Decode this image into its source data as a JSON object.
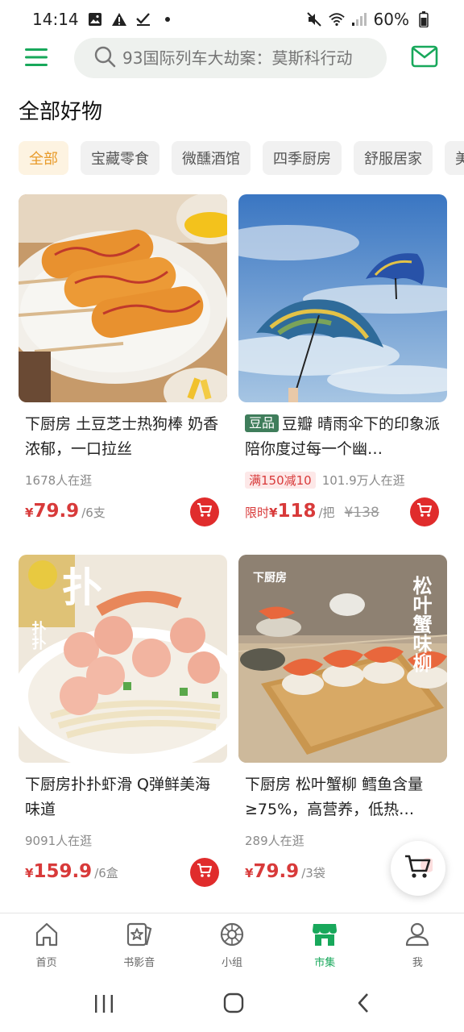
{
  "status_bar": {
    "time": "14:14",
    "battery": "60%"
  },
  "search": {
    "placeholder": "93国际列车大劫案：莫斯科行动"
  },
  "page_title": "全部好物",
  "chips": [
    "全部",
    "宝藏零食",
    "微醺酒馆",
    "四季厨房",
    "舒服居家",
    "美"
  ],
  "products": [
    {
      "title": "下厨房 土豆芝士热狗棒 奶香浓郁，一口拉丝",
      "tag": "",
      "meta": "1678人在逛",
      "coupon": "",
      "price_prefix": "",
      "currency": "¥",
      "price": "79.9",
      "unit": "/6支",
      "old_price": ""
    },
    {
      "title": "豆瓣 晴雨伞下的印象派 陪你度过每一个幽…",
      "tag": "豆品",
      "meta": "101.9万人在逛",
      "coupon": "满150减10",
      "price_prefix": "限时",
      "currency": "¥",
      "price": "118",
      "unit": "/把",
      "old_price": "¥138"
    },
    {
      "title": "下厨房扑扑虾滑 Q弹鲜美海味道",
      "tag": "",
      "meta": "9091人在逛",
      "coupon": "",
      "price_prefix": "",
      "currency": "¥",
      "price": "159.9",
      "unit": "/6盒",
      "old_price": ""
    },
    {
      "title": "下厨房 松叶蟹柳 鳕鱼含量≥75%，高营养，低热…",
      "tag": "",
      "meta": "289人在逛",
      "coupon": "",
      "price_prefix": "",
      "currency": "¥",
      "price": "79.9",
      "unit": "/3袋",
      "old_price": ""
    }
  ],
  "image_text": {
    "shrimp_big": "扑",
    "shrimp_small": "扑扑",
    "crab_brand": "下厨房",
    "crab_name": "松叶蟹味柳"
  },
  "bottom_nav": [
    "首页",
    "书影音",
    "小组",
    "市集",
    "我"
  ],
  "colors": {
    "brand_green": "#18a85b",
    "price_red": "#d83a3a",
    "cart_red": "#e02c2c",
    "chip_active": "#e89b2a"
  }
}
